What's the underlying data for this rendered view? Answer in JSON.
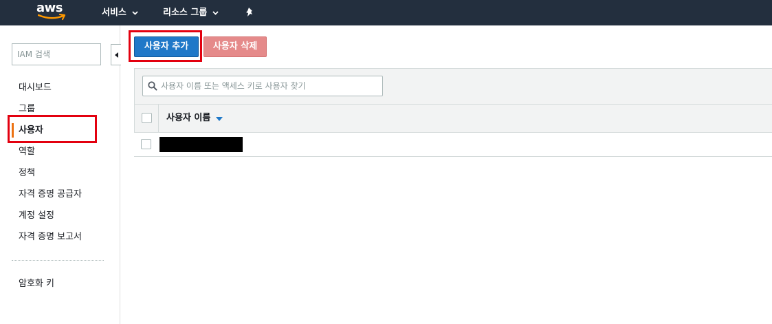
{
  "topbar": {
    "logo": "aws",
    "services_label": "서비스",
    "resource_groups_label": "리소스 그룹"
  },
  "sidebar": {
    "search_placeholder": "IAM 검색",
    "items": [
      {
        "label": "대시보드"
      },
      {
        "label": "그룹"
      },
      {
        "label": "사용자",
        "active": true
      },
      {
        "label": "역할"
      },
      {
        "label": "정책"
      },
      {
        "label": "자격 증명 공급자"
      },
      {
        "label": "계정 설정"
      },
      {
        "label": "자격 증명 보고서"
      }
    ],
    "bottom_items": [
      {
        "label": "암호화 키"
      }
    ]
  },
  "main": {
    "add_user_label": "사용자 추가",
    "delete_user_label": "사용자 삭제",
    "search_placeholder": "사용자 이름 또는 액세스 키로 사용자 찾기",
    "table": {
      "columns": [
        "사용자 이름"
      ]
    }
  },
  "colors": {
    "topbar_bg": "#232f3e",
    "primary_button": "#1f78c8",
    "disabled_delete": "#e58a8a",
    "active_indicator": "#ec7211",
    "highlight": "#e3000f"
  }
}
